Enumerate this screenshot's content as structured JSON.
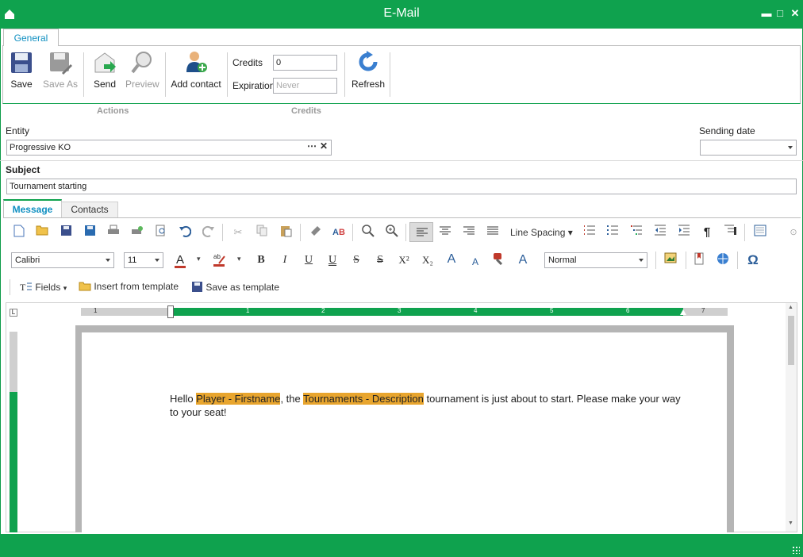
{
  "window": {
    "title": "E-Mail",
    "minimize": "▬",
    "restore": "□",
    "close": "✕"
  },
  "ribbon": {
    "tab_general": "General",
    "buttons": {
      "save": "Save",
      "save_as": "Save As",
      "send": "Send",
      "preview": "Preview",
      "add_contact": "Add contact",
      "refresh": "Refresh"
    },
    "credits_label": "Credits",
    "credits_value": "0",
    "expiration_label": "Expiration",
    "expiration_placeholder": "Never",
    "group_actions": "Actions",
    "group_credits": "Credits"
  },
  "form": {
    "entity_label": "Entity",
    "entity_value": "Progressive KO",
    "sending_date_label": "Sending date",
    "sending_date_value": "",
    "subject_label": "Subject",
    "subject_value": "Tournament starting"
  },
  "message_tabs": {
    "message": "Message",
    "contacts": "Contacts"
  },
  "editor": {
    "line_spacing": "Line Spacing",
    "font_name": "Calibri",
    "font_size": "11",
    "style": "Normal",
    "fields": "Fields",
    "insert_template": "Insert from template",
    "save_template": "Save as template",
    "ruler_numbers": [
      "1",
      "1",
      "2",
      "3",
      "4",
      "5",
      "6",
      "7"
    ],
    "body": {
      "t1": "Hello ",
      "f1": "Player - Firstname",
      "t2": ", the ",
      "f2": "Tournaments - Description",
      "t3": " tournament is just about to start. Please make your way to your seat!"
    }
  },
  "colors": {
    "accent": "#0fa24e",
    "field_highlight": "#e8a52e",
    "link": "#0f8fc1"
  }
}
